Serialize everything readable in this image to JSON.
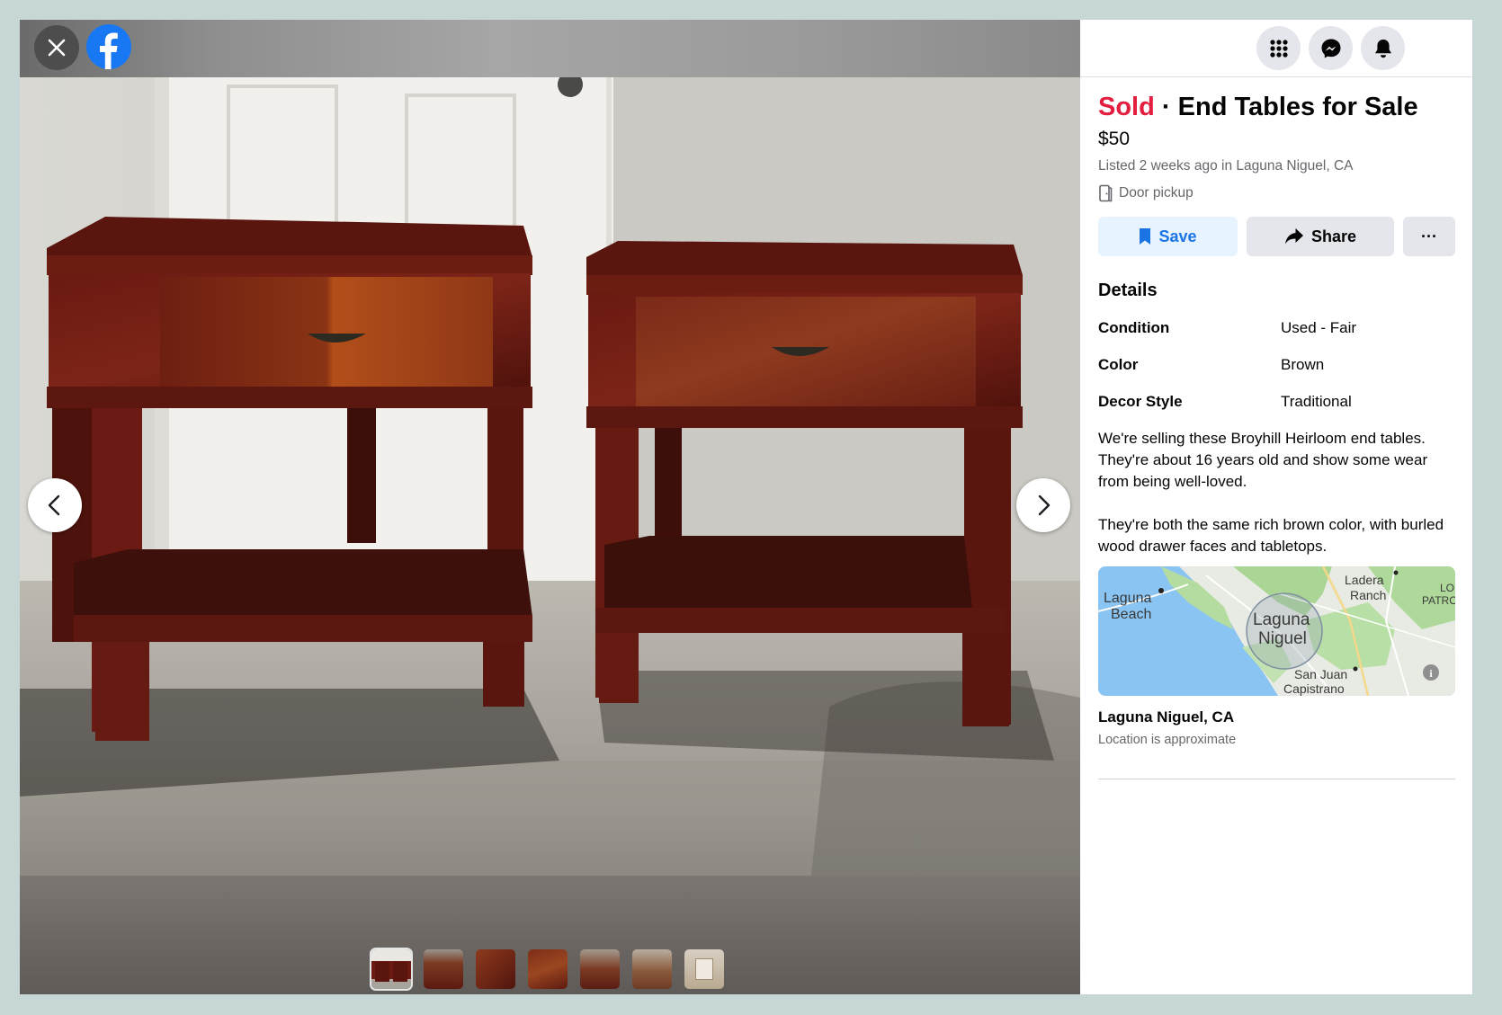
{
  "listing": {
    "status": "Sold",
    "separator": "·",
    "title": "End Tables for Sale",
    "price": "$50",
    "listed": "Listed 2 weeks ago in Laguna Niguel, CA",
    "pickup": "Door pickup"
  },
  "actions": {
    "save_label": "Save",
    "share_label": "Share",
    "more_label": "···"
  },
  "details": {
    "heading": "Details",
    "rows": [
      {
        "label": "Condition",
        "value": "Used - Fair"
      },
      {
        "label": "Color",
        "value": "Brown"
      },
      {
        "label": "Decor Style",
        "value": "Traditional"
      }
    ],
    "description": [
      "We're selling these Broyhill Heirloom end tables. They're about 16 years old and show some wear from being well-loved.",
      "They're both the same rich brown color, with burled wood drawer faces and tabletops."
    ]
  },
  "map": {
    "labels": {
      "laguna_beach_1": "Laguna",
      "laguna_beach_2": "Beach",
      "laguna_niguel_1": "Laguna",
      "laguna_niguel_2": "Niguel",
      "ladera_1": "Ladera",
      "ladera_2": "Ranch",
      "patrol_1": "LO",
      "patrol_2": "PATRO",
      "san_juan_1": "San Juan",
      "san_juan_2": "Capistrano"
    },
    "location_name": "Laguna Niguel, CA",
    "location_note": "Location is approximate"
  },
  "viewer": {
    "thumbnail_count": 7,
    "active_thumbnail": 1
  },
  "icons": {
    "close": "close-icon",
    "brand": "facebook-logo",
    "prev": "chevron-left-icon",
    "next": "chevron-right-icon",
    "menu": "grid-menu-icon",
    "messenger": "messenger-icon",
    "notifications": "bell-icon",
    "pickup": "door-icon",
    "save": "bookmark-icon",
    "share": "share-arrow-icon"
  },
  "colors": {
    "sold": "#e41e3f",
    "brand_blue": "#1877f2",
    "save_text": "#1b74e4",
    "save_bg": "#e7f3ff",
    "button_gray": "#e4e6eb",
    "secondary_text": "#65676b"
  }
}
